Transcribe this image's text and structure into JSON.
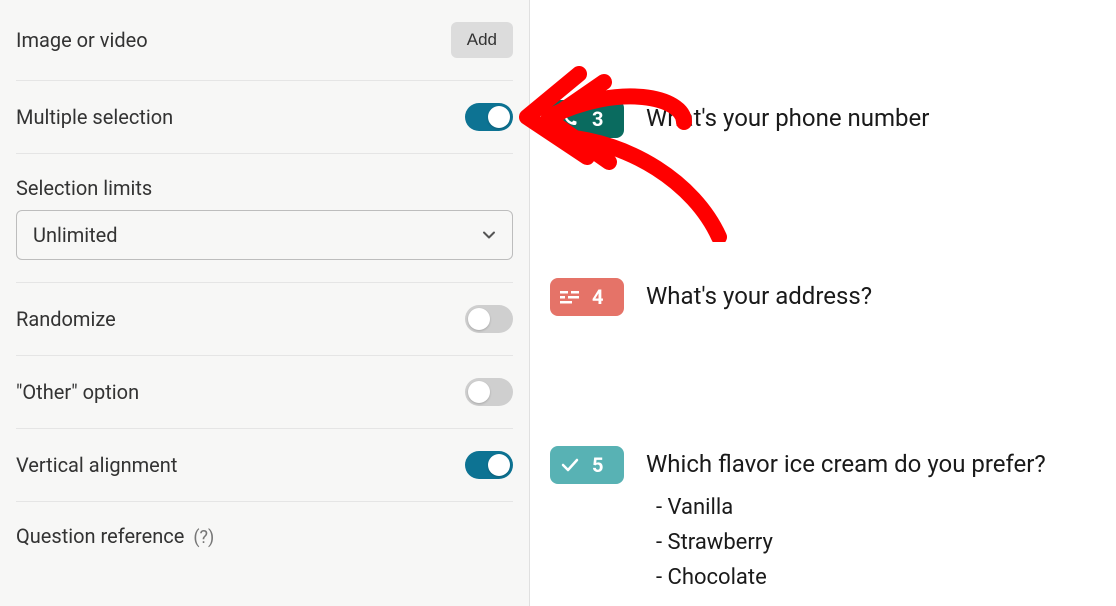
{
  "sidebar": {
    "imageVideo": {
      "label": "Image or video",
      "buttonLabel": "Add"
    },
    "multipleSelection": {
      "label": "Multiple selection",
      "value": true
    },
    "selectionLimits": {
      "label": "Selection limits",
      "selected": "Unlimited"
    },
    "randomize": {
      "label": "Randomize",
      "value": false
    },
    "otherOption": {
      "label": "\"Other\" option",
      "value": false
    },
    "verticalAlignment": {
      "label": "Vertical alignment",
      "value": true
    },
    "questionReference": {
      "label": "Question reference",
      "help": "(?)"
    }
  },
  "questions": [
    {
      "number": "3",
      "text": "What's your phone number",
      "type": "phone",
      "badgeColor": "#0a6b5f"
    },
    {
      "number": "4",
      "text": "What's your address?",
      "type": "address",
      "badgeColor": "#e57368"
    },
    {
      "number": "5",
      "text": "Which flavor ice cream do you prefer?",
      "type": "multiple-choice",
      "badgeColor": "#58b2b4",
      "choices": [
        "- Vanilla",
        "- Strawberry",
        "- Chocolate"
      ]
    }
  ],
  "colors": {
    "accentTeal": "#0d7393",
    "toggleOff": "#cfcfcf",
    "annotationRed": "#ff0000"
  }
}
